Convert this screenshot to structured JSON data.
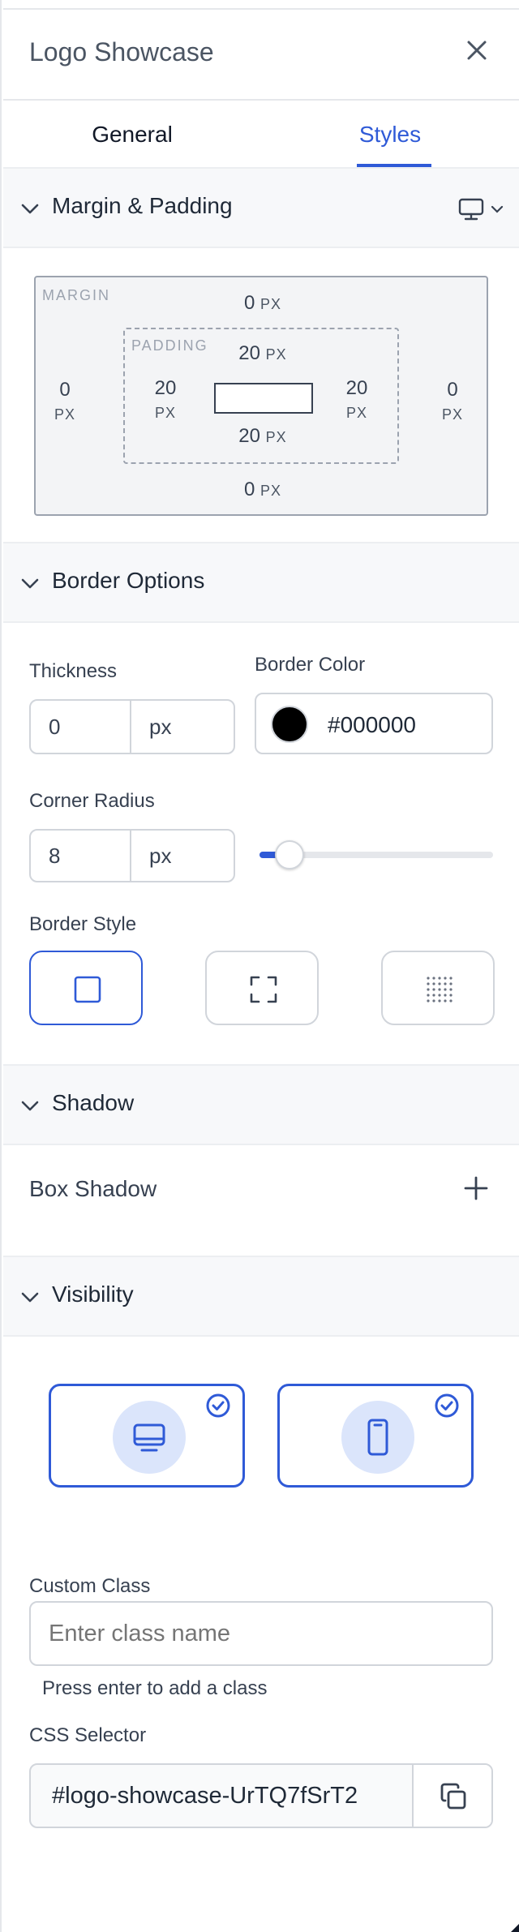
{
  "header": {
    "title": "Logo Showcase",
    "close_icon": "close-icon"
  },
  "tabs": [
    {
      "label": "General",
      "active": false
    },
    {
      "label": "Styles",
      "active": true
    }
  ],
  "accent_color": "#2f5ad7",
  "margin_padding": {
    "title": "Margin & Padding",
    "device_icon": "desktop-icon",
    "margin_label": "MARGIN",
    "padding_label": "PADDING",
    "unit": "PX",
    "margin": {
      "top": "0",
      "right": "0",
      "bottom": "0",
      "left": "0"
    },
    "padding": {
      "top": "20",
      "right": "20",
      "bottom": "20",
      "left": "20"
    }
  },
  "border_options": {
    "title": "Border Options",
    "thickness_label": "Thickness",
    "thickness_value": "0",
    "thickness_unit": "px",
    "color_label": "Border Color",
    "color_value": "#000000",
    "swatch_color": "#000000",
    "radius_label": "Corner Radius",
    "radius_value": "8",
    "radius_unit": "px",
    "radius_slider_fraction": 0.13,
    "style_label": "Border Style",
    "styles": [
      {
        "icon": "solid-border-icon",
        "selected": true
      },
      {
        "icon": "corners-border-icon",
        "selected": false
      },
      {
        "icon": "dotted-border-icon",
        "selected": false
      }
    ]
  },
  "shadow": {
    "title": "Shadow",
    "box_shadow_label": "Box Shadow",
    "add_icon": "plus-icon"
  },
  "visibility": {
    "title": "Visibility",
    "devices": [
      {
        "icon": "desktop-icon",
        "checked": true
      },
      {
        "icon": "mobile-icon",
        "checked": true
      }
    ],
    "custom_class_label": "Custom Class",
    "custom_class_placeholder": "Enter class name",
    "custom_class_hint": "Press enter to add a class",
    "css_selector_label": "CSS Selector",
    "css_selector_value": "#logo-showcase-UrTQ7fSrT2",
    "copy_icon": "copy-icon"
  }
}
